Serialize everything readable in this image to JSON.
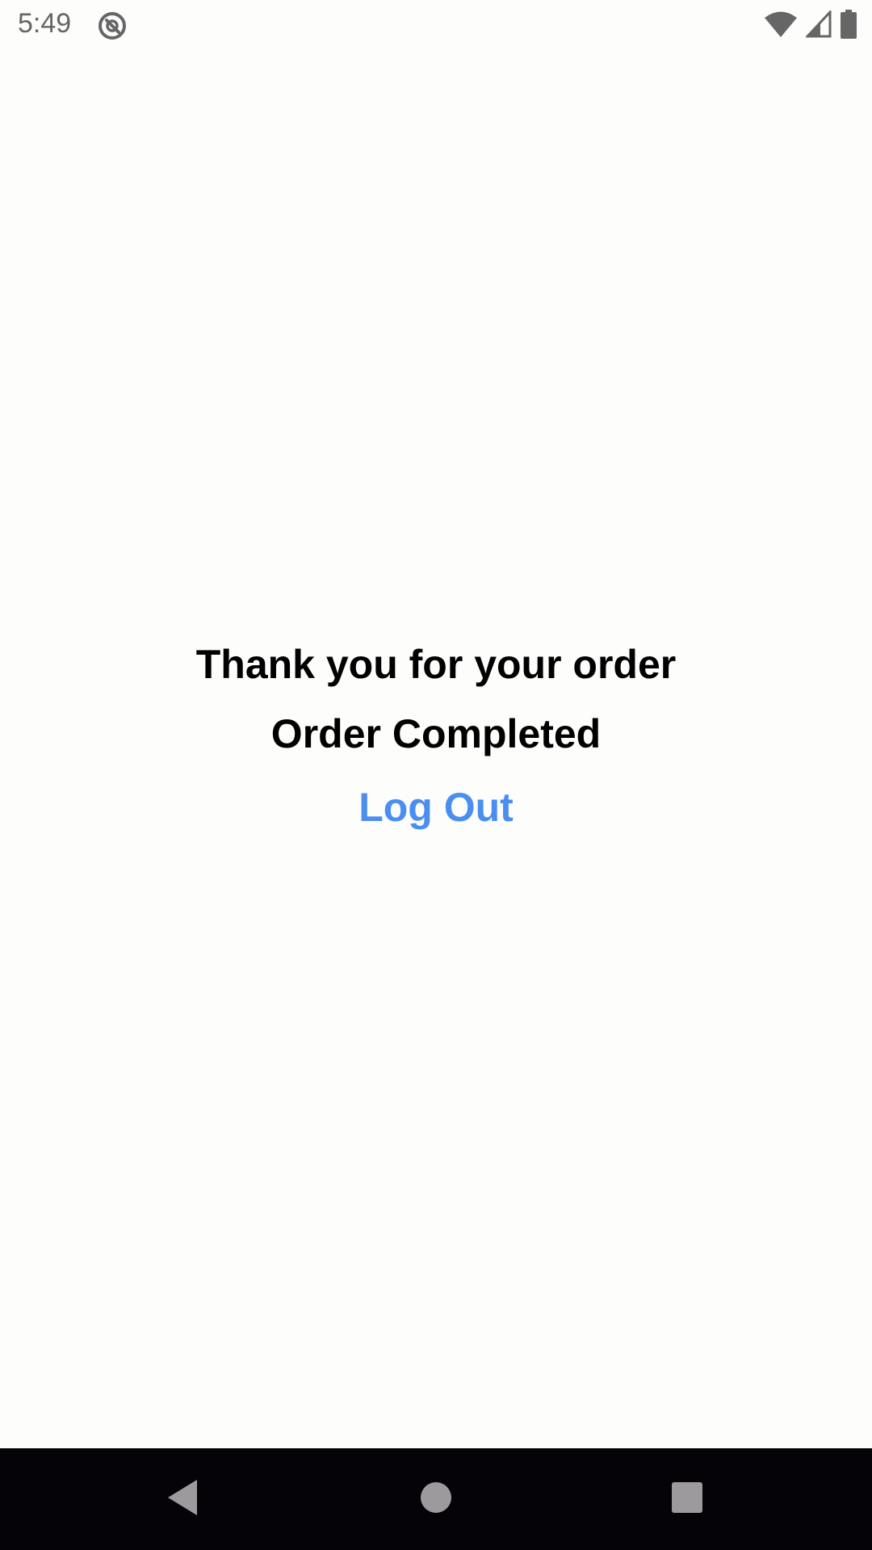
{
  "status_bar": {
    "time": "5:49",
    "app_icon": "data-saver-icon",
    "wifi_icon": "wifi-icon",
    "signal_icon": "cell-signal-icon",
    "battery_icon": "battery-icon",
    "icon_color": "#666666"
  },
  "main": {
    "thanks_message": "Thank you for your order",
    "order_status": "Order Completed",
    "logout_label": "Log Out",
    "accent_color": "#4a8ff0"
  },
  "nav_bar": {
    "back_icon": "back-triangle-icon",
    "home_icon": "home-circle-icon",
    "recents_icon": "recents-square-icon",
    "background": "#050307"
  }
}
